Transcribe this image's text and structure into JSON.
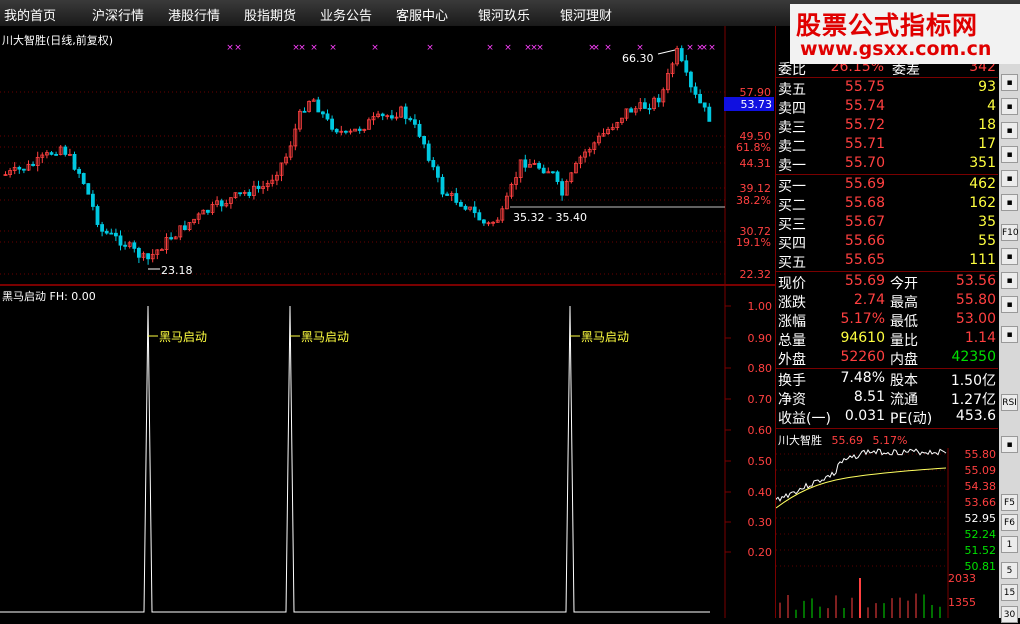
{
  "menu": {
    "items": [
      "我的首页",
      "沪深行情",
      "港股行情",
      "股指期货",
      "业务公告",
      "客服中心",
      "银河玖乐",
      "银河理财"
    ]
  },
  "watermark": {
    "line1": "股票公式指标网",
    "line2": "www.gsxx.com.cn"
  },
  "stock_chart": {
    "title": "川大智胜(日线,前复权)",
    "price_axis": [
      "57.90",
      "49.50",
      "44.31",
      "39.12",
      "30.72",
      "22.32"
    ],
    "pct_axis": [
      "61.8%",
      "38.2%",
      "19.1%"
    ],
    "current_price_tag": "53.73",
    "annotations": {
      "high": "66.30",
      "low": "23.18",
      "range": "35.32 - 35.40"
    }
  },
  "indicator": {
    "title": "黑马启动 FH: 0.00",
    "axis": [
      "1.00",
      "0.90",
      "0.80",
      "0.70",
      "0.60",
      "0.50",
      "0.40",
      "0.30",
      "0.20"
    ],
    "signal_label": "黑马启动"
  },
  "quote": {
    "weibi": {
      "label": "委比",
      "value": "26.15%",
      "label2": "委差",
      "value2": "342"
    },
    "asks": [
      {
        "label": "卖五",
        "price": "55.75",
        "vol": "93"
      },
      {
        "label": "卖四",
        "price": "55.74",
        "vol": "4"
      },
      {
        "label": "卖三",
        "price": "55.72",
        "vol": "18"
      },
      {
        "label": "卖二",
        "price": "55.71",
        "vol": "17"
      },
      {
        "label": "卖一",
        "price": "55.70",
        "vol": "351"
      }
    ],
    "bids": [
      {
        "label": "买一",
        "price": "55.69",
        "vol": "462"
      },
      {
        "label": "买二",
        "price": "55.68",
        "vol": "162"
      },
      {
        "label": "买三",
        "price": "55.67",
        "vol": "35"
      },
      {
        "label": "买四",
        "price": "55.66",
        "vol": "55"
      },
      {
        "label": "买五",
        "price": "55.65",
        "vol": "111"
      }
    ],
    "stats": [
      {
        "l1": "现价",
        "v1": "55.69",
        "l2": "今开",
        "v2": "53.56"
      },
      {
        "l1": "涨跌",
        "v1": "2.74",
        "l2": "最高",
        "v2": "55.80"
      },
      {
        "l1": "涨幅",
        "v1": "5.17%",
        "l2": "最低",
        "v2": "53.00"
      },
      {
        "l1": "总量",
        "v1": "94610",
        "l2": "量比",
        "v2": "1.14"
      },
      {
        "l1": "外盘",
        "v1": "52260",
        "l2": "内盘",
        "v2": "42350"
      }
    ],
    "fundamentals": [
      {
        "l1": "换手",
        "v1": "7.48%",
        "l2": "股本",
        "v2": "1.50亿"
      },
      {
        "l1": "净资",
        "v1": "8.51",
        "l2": "流通",
        "v2": "1.27亿"
      },
      {
        "l1": "收益(一)",
        "v1": "0.031",
        "l2": "PE(动)",
        "v2": "453.6"
      }
    ]
  },
  "mini_chart": {
    "name": "川大智胜",
    "price": "55.69",
    "pct": "5.17%",
    "axis": [
      "55.80",
      "55.09",
      "54.38",
      "53.66",
      "52.95",
      "52.24",
      "51.52",
      "50.81"
    ],
    "vol_axis": [
      "2033",
      "1355"
    ]
  },
  "toolbar": {
    "buttons": [
      "F10",
      "RSI",
      "F5",
      "F6",
      "1",
      "5",
      "15",
      "30"
    ]
  },
  "colors": {
    "up": "#ff4040",
    "down": "#00e0e0",
    "magenta": "#ff40ff"
  }
}
